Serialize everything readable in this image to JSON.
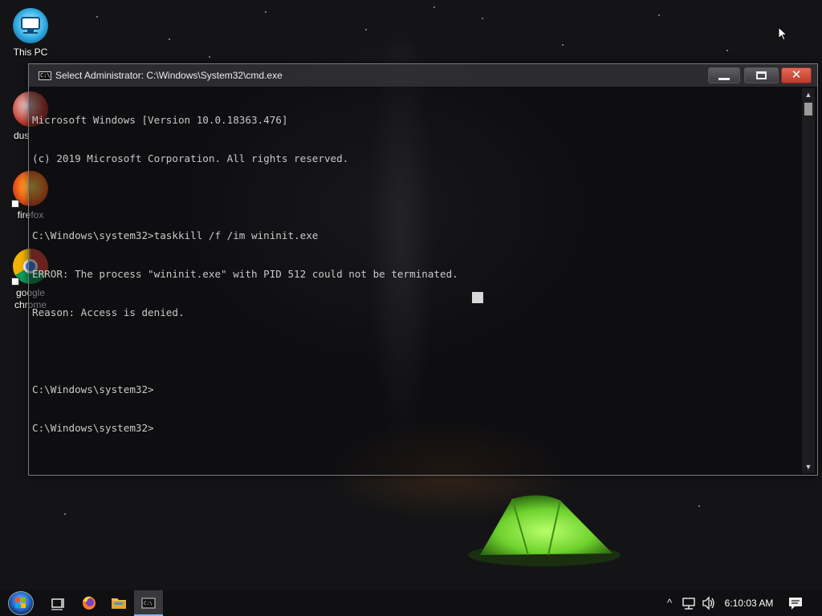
{
  "desktop": {
    "icons": [
      {
        "label": "This PC"
      },
      {
        "label": "dus"
      },
      {
        "label": "firefox"
      },
      {
        "label": "google chrome"
      }
    ]
  },
  "window": {
    "title": "Select Administrator: C:\\Windows\\System32\\cmd.exe",
    "app_icon_text": "C:\\",
    "buttons": {
      "minimize": "minimize",
      "maximize": "maximize",
      "close": "✕"
    }
  },
  "console": {
    "lines": [
      "Microsoft Windows [Version 10.0.18363.476]",
      "(c) 2019 Microsoft Corporation. All rights reserved.",
      "",
      "C:\\Windows\\system32>taskkill /f /im wininit.exe",
      "ERROR: The process \"wininit.exe\" with PID 512 could not be terminated.",
      "Reason: Access is denied.",
      "",
      "C:\\Windows\\system32>",
      "C:\\Windows\\system32>"
    ]
  },
  "scrollbar": {
    "up_arrow": "▲",
    "down_arrow": "▼"
  },
  "taskbar": {
    "icons": [
      "start-orb-icon",
      "task-view-icon",
      "firefox-icon",
      "file-explorer-icon",
      "cmd-icon"
    ],
    "tray_chevron": "^",
    "clock": "6:10:03 AM"
  },
  "colors": {
    "close_button": "#c0392b",
    "console_text": "#c8c8c8",
    "tent_green": "#7ee83a"
  }
}
